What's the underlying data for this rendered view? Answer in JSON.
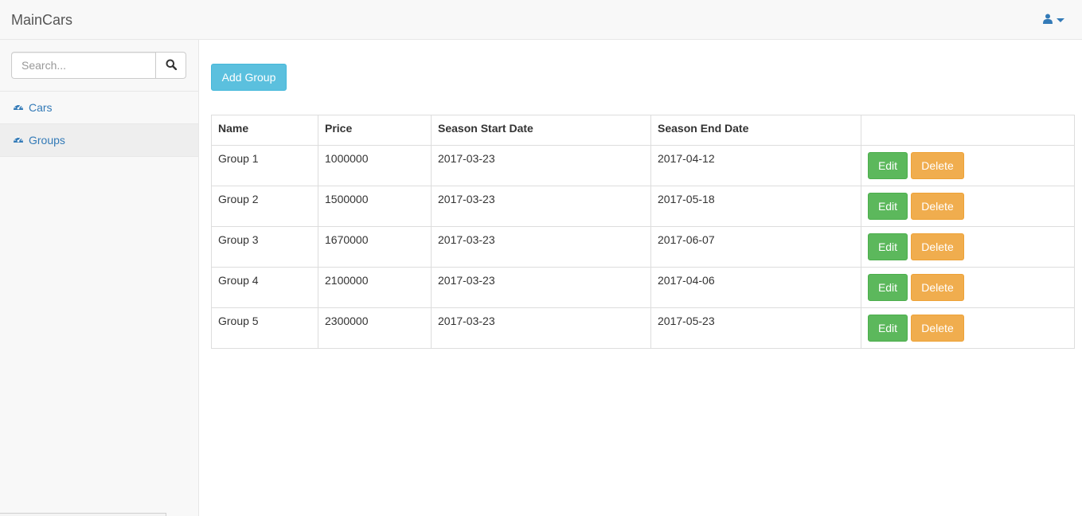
{
  "navbar": {
    "brand": "MainCars",
    "user_icon": "user-icon"
  },
  "sidebar": {
    "search_placeholder": "Search...",
    "items": [
      {
        "label": "Cars",
        "icon": "dashboard-icon",
        "active": false
      },
      {
        "label": "Groups",
        "icon": "dashboard-icon",
        "active": true
      }
    ]
  },
  "main": {
    "add_button_label": "Add Group",
    "table": {
      "headers": [
        "Name",
        "Price",
        "Season Start Date",
        "Season End Date",
        ""
      ],
      "rows": [
        {
          "name": "Group 1",
          "price": "1000000",
          "start": "2017-03-23",
          "end": "2017-04-12"
        },
        {
          "name": "Group 2",
          "price": "1500000",
          "start": "2017-03-23",
          "end": "2017-05-18"
        },
        {
          "name": "Group 3",
          "price": "1670000",
          "start": "2017-03-23",
          "end": "2017-06-07"
        },
        {
          "name": "Group 4",
          "price": "2100000",
          "start": "2017-03-23",
          "end": "2017-04-06"
        },
        {
          "name": "Group 5",
          "price": "2300000",
          "start": "2017-03-23",
          "end": "2017-05-23"
        }
      ],
      "edit_label": "Edit",
      "delete_label": "Delete"
    }
  },
  "colors": {
    "link": "#337ab7",
    "info": "#5bc0de",
    "success": "#5cb85c",
    "warning": "#f0ad4e"
  }
}
